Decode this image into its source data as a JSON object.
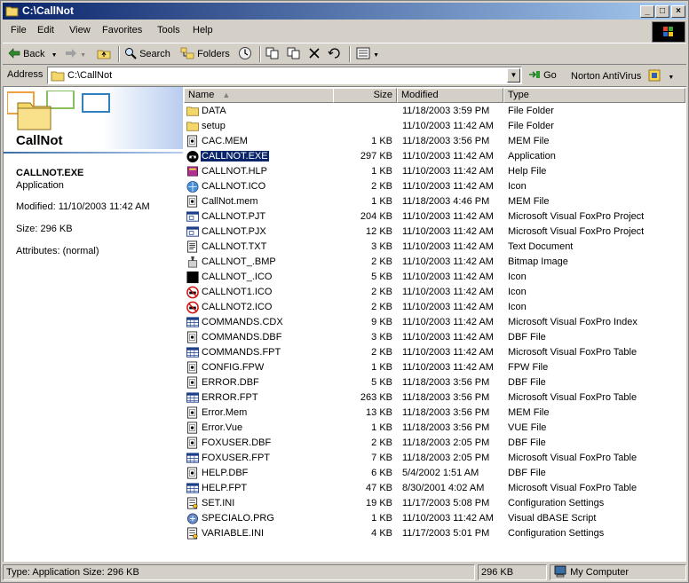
{
  "window": {
    "title": "C:\\CallNot",
    "min": "_",
    "max": "□",
    "close": "×"
  },
  "menu": [
    "File",
    "Edit",
    "View",
    "Favorites",
    "Tools",
    "Help"
  ],
  "toolbar": {
    "back": "Back",
    "search": "Search",
    "folders": "Folders"
  },
  "address": {
    "label": "Address",
    "value": "C:\\CallNot",
    "go": "Go",
    "norton": "Norton AntiVirus"
  },
  "leftpane": {
    "folder_name": "CallNot",
    "selected_name": "CALLNOT.EXE",
    "selected_type": "Application",
    "modified": "Modified: 11/10/2003 11:42 AM",
    "size": "Size: 296 KB",
    "attributes": "Attributes: (normal)"
  },
  "columns": {
    "name": "Name",
    "size": "Size",
    "modified": "Modified",
    "type": "Type"
  },
  "files": [
    {
      "name": "DATA",
      "size": "",
      "modified": "11/18/2003 3:59 PM",
      "type": "File Folder",
      "icon": "folder-icon"
    },
    {
      "name": "setup",
      "size": "",
      "modified": "11/10/2003 11:42 AM",
      "type": "File Folder",
      "icon": "folder-icon"
    },
    {
      "name": "CAC.MEM",
      "size": "1 KB",
      "modified": "11/18/2003 3:56 PM",
      "type": "MEM File",
      "icon": "file-icon"
    },
    {
      "name": "CALLNOT.EXE",
      "size": "297 KB",
      "modified": "11/10/2003 11:42 AM",
      "type": "Application",
      "icon": "phone-icon",
      "selected": true
    },
    {
      "name": "CALLNOT.HLP",
      "size": "1 KB",
      "modified": "11/10/2003 11:42 AM",
      "type": "Help File",
      "icon": "help-book-icon"
    },
    {
      "name": "CALLNOT.ICO",
      "size": "2 KB",
      "modified": "11/10/2003 11:42 AM",
      "type": "Icon",
      "icon": "globe-icon"
    },
    {
      "name": "CallNot.mem",
      "size": "1 KB",
      "modified": "11/18/2003 4:46 PM",
      "type": "MEM File",
      "icon": "file-icon"
    },
    {
      "name": "CALLNOT.PJT",
      "size": "204 KB",
      "modified": "11/10/2003 11:42 AM",
      "type": "Microsoft Visual FoxPro Project",
      "icon": "project-icon"
    },
    {
      "name": "CALLNOT.PJX",
      "size": "12 KB",
      "modified": "11/10/2003 11:42 AM",
      "type": "Microsoft Visual FoxPro Project",
      "icon": "project-icon"
    },
    {
      "name": "CALLNOT.TXT",
      "size": "3 KB",
      "modified": "11/10/2003 11:42 AM",
      "type": "Text Document",
      "icon": "text-file-icon"
    },
    {
      "name": "CALLNOT_.BMP",
      "size": "2 KB",
      "modified": "11/10/2003 11:42 AM",
      "type": "Bitmap Image",
      "icon": "paint-icon"
    },
    {
      "name": "CALLNOT_.ICO",
      "size": "5 KB",
      "modified": "11/10/2003 11:42 AM",
      "type": "Icon",
      "icon": "black-square-icon"
    },
    {
      "name": "CALLNOT1.ICO",
      "size": "2 KB",
      "modified": "11/10/2003 11:42 AM",
      "type": "Icon",
      "icon": "no-phone-icon"
    },
    {
      "name": "CALLNOT2.ICO",
      "size": "2 KB",
      "modified": "11/10/2003 11:42 AM",
      "type": "Icon",
      "icon": "no-phone-icon"
    },
    {
      "name": "COMMANDS.CDX",
      "size": "9 KB",
      "modified": "11/10/2003 11:42 AM",
      "type": "Microsoft Visual FoxPro Index",
      "icon": "table-icon"
    },
    {
      "name": "COMMANDS.DBF",
      "size": "3 KB",
      "modified": "11/10/2003 11:42 AM",
      "type": "DBF File",
      "icon": "file-icon"
    },
    {
      "name": "COMMANDS.FPT",
      "size": "2 KB",
      "modified": "11/10/2003 11:42 AM",
      "type": "Microsoft Visual FoxPro Table",
      "icon": "table-icon"
    },
    {
      "name": "CONFIG.FPW",
      "size": "1 KB",
      "modified": "11/10/2003 11:42 AM",
      "type": "FPW File",
      "icon": "file-icon"
    },
    {
      "name": "ERROR.DBF",
      "size": "5 KB",
      "modified": "11/18/2003 3:56 PM",
      "type": "DBF File",
      "icon": "file-icon"
    },
    {
      "name": "ERROR.FPT",
      "size": "263 KB",
      "modified": "11/18/2003 3:56 PM",
      "type": "Microsoft Visual FoxPro Table",
      "icon": "table-icon"
    },
    {
      "name": "Error.Mem",
      "size": "13 KB",
      "modified": "11/18/2003 3:56 PM",
      "type": "MEM File",
      "icon": "file-icon"
    },
    {
      "name": "Error.Vue",
      "size": "1 KB",
      "modified": "11/18/2003 3:56 PM",
      "type": "VUE File",
      "icon": "file-icon"
    },
    {
      "name": "FOXUSER.DBF",
      "size": "2 KB",
      "modified": "11/18/2003 2:05 PM",
      "type": "DBF File",
      "icon": "file-icon"
    },
    {
      "name": "FOXUSER.FPT",
      "size": "7 KB",
      "modified": "11/18/2003 2:05 PM",
      "type": "Microsoft Visual FoxPro Table",
      "icon": "table-icon"
    },
    {
      "name": "HELP.DBF",
      "size": "6 KB",
      "modified": "5/4/2002 1:51 AM",
      "type": "DBF File",
      "icon": "file-icon"
    },
    {
      "name": "HELP.FPT",
      "size": "47 KB",
      "modified": "8/30/2001 4:02 AM",
      "type": "Microsoft Visual FoxPro Table",
      "icon": "table-icon"
    },
    {
      "name": "SET.INI",
      "size": "19 KB",
      "modified": "11/17/2003 5:08 PM",
      "type": "Configuration Settings",
      "icon": "ini-icon"
    },
    {
      "name": "SPECIALO.PRG",
      "size": "1 KB",
      "modified": "11/10/2003 11:42 AM",
      "type": "Visual dBASE Script",
      "icon": "script-icon"
    },
    {
      "name": "VARIABLE.INI",
      "size": "4 KB",
      "modified": "11/17/2003 5:01 PM",
      "type": "Configuration Settings",
      "icon": "ini-icon"
    }
  ],
  "status": {
    "left": "Type: Application Size: 296 KB",
    "size": "296 KB",
    "location": "My Computer"
  }
}
